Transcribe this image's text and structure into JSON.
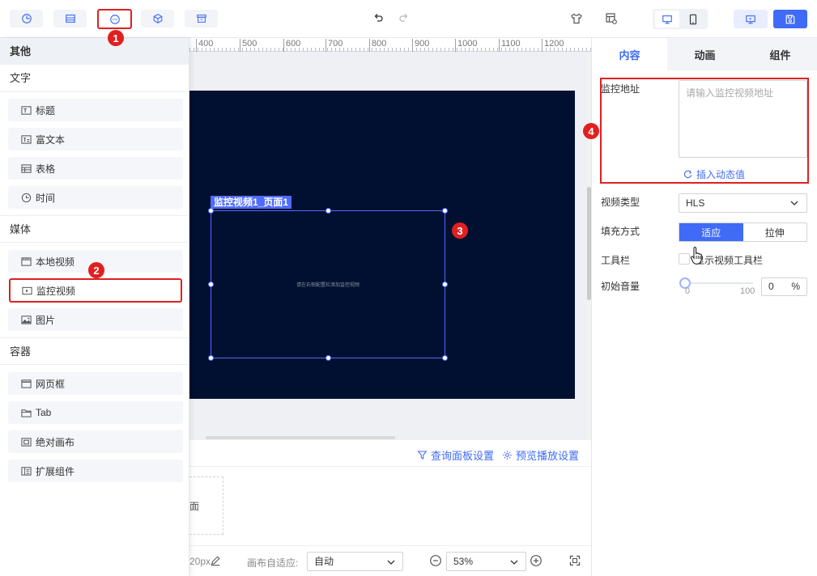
{
  "toolbar": {
    "left_icons": [
      "clock-icon",
      "table-icon",
      "more-icon",
      "cube-icon",
      "archive-icon"
    ],
    "center_icons": [
      "undo-icon",
      "redo-icon"
    ],
    "right_icons": [
      "theme-icon",
      "layout-settings-icon",
      "desktop-icon",
      "mobile-icon",
      "preview-icon",
      "save-icon"
    ]
  },
  "annotations": [
    "1",
    "2",
    "3",
    "4"
  ],
  "left_panel": {
    "header": "其他",
    "groups": [
      {
        "title": "文字",
        "items": [
          "标题",
          "富文本",
          "表格",
          "时间"
        ]
      },
      {
        "title": "媒体",
        "items": [
          "本地视频",
          "监控视频",
          "图片"
        ]
      },
      {
        "title": "容器",
        "items": [
          "网页框",
          "Tab",
          "绝对画布",
          "扩展组件"
        ]
      }
    ]
  },
  "canvas": {
    "ruler_labels": [
      "400",
      "500",
      "600",
      "700",
      "800",
      "900",
      "1000",
      "1100",
      "1200"
    ],
    "widget_tag": "监控视频1_页面1",
    "widget_hint": "请在右侧配置栏添加监控视频",
    "stage_color": "#011030",
    "accent": "#4f6bff"
  },
  "bottom": {
    "query_settings": "查询面板设置",
    "play_settings": "预览播放设置",
    "page_card_label": "面"
  },
  "statusbar": {
    "size_fragment": "20px",
    "fit_label": "画布自适应:",
    "fit_value": "自动",
    "zoom_value": "53%"
  },
  "right_panel": {
    "tabs": [
      "内容",
      "动画",
      "组件"
    ],
    "active_tab": "内容",
    "url_label": "监控地址",
    "url_placeholder": "请输入监控视频地址",
    "insert_dynamic": "插入动态值",
    "type_label": "视频类型",
    "type_value": "HLS",
    "fill_label": "填充方式",
    "fill_options": [
      "适应",
      "拉伸"
    ],
    "toolbar_label": "工具栏",
    "toolbar_checkbox": "显示视频工具栏",
    "volume_label": "初始音量",
    "volume_min": "0",
    "volume_max": "100",
    "volume_value": "0",
    "volume_unit": "%"
  },
  "colors": {
    "primary": "#3f6bf6",
    "highlight": "#e02020"
  }
}
